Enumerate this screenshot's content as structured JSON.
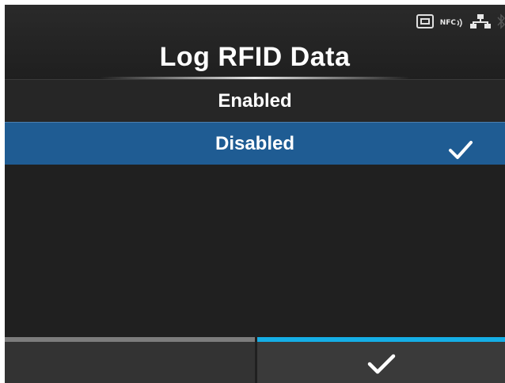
{
  "header": {
    "title": "Log RFID Data",
    "status_icons": {
      "sd_card": "sd-card-icon",
      "nfc_label": "NFC",
      "network": "network-icon",
      "bluetooth": "bluetooth-icon"
    }
  },
  "options": [
    {
      "label": "Enabled",
      "selected": false
    },
    {
      "label": "Disabled",
      "selected": true
    }
  ],
  "footer": {
    "left_button": "",
    "confirm_icon": "check-icon"
  },
  "colors": {
    "background": "#202020",
    "selected_row": "#1f5c93",
    "confirm_accent": "#15aee6",
    "left_accent": "#7d7d7d"
  }
}
